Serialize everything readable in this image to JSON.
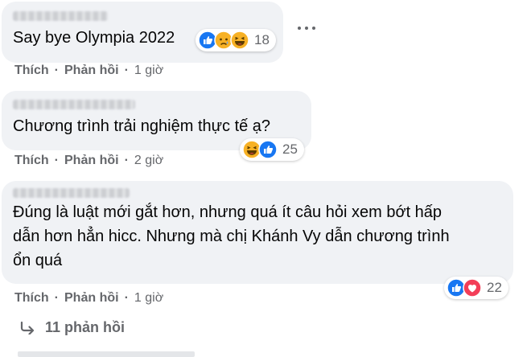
{
  "comments": [
    {
      "text": "Say bye Olympia 2022",
      "actions": {
        "like": "Thích",
        "reply": "Phản hồi",
        "separator": "·",
        "time": "1 giờ"
      },
      "reactions": {
        "icons": [
          "like-icon",
          "sad-icon",
          "haha-icon"
        ],
        "count": "18"
      }
    },
    {
      "text": "Chương trình trải nghiệm thực tế ạ?",
      "actions": {
        "like": "Thích",
        "reply": "Phản hồi",
        "separator": "·",
        "time": "2 giờ"
      },
      "reactions": {
        "icons": [
          "haha-icon",
          "like-icon"
        ],
        "count": "25"
      }
    },
    {
      "text": "Đúng là luật mới gắt hơn, nhưng quá ít câu hỏi xem bớt hấp\ndẫn hơn hẳn hicc. Nhưng mà chị Khánh Vy dẫn chương trình\nổn quá",
      "actions": {
        "like": "Thích",
        "reply": "Phản hồi",
        "separator": "·",
        "time": "1 giờ"
      },
      "reactions": {
        "icons": [
          "like-icon",
          "love-icon"
        ],
        "count": "22"
      }
    }
  ],
  "replies": {
    "label": "11 phản hồi",
    "icon": "reply-arrow-icon"
  },
  "menu": {
    "icon": "more-options-icon"
  },
  "colors": {
    "bubble": "#f0f2f5",
    "secondary_text": "#65676b",
    "like_blue": "#1877f2",
    "love_red": "#f33e58",
    "emoji_yellow": "#f7b125"
  }
}
